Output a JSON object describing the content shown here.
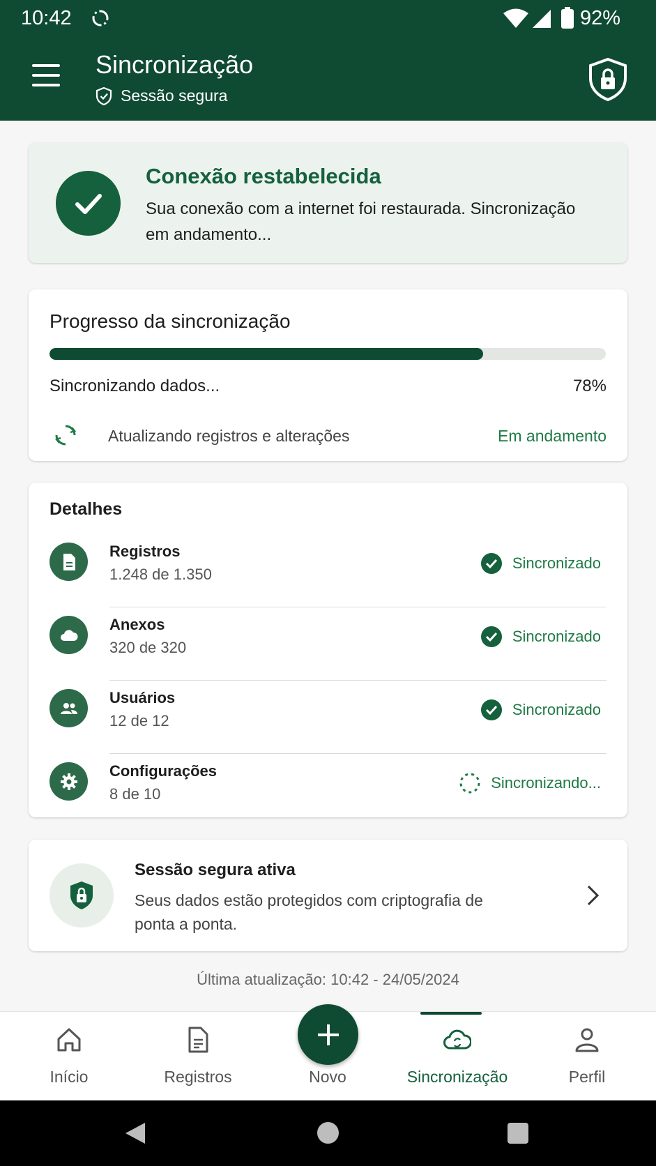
{
  "status_bar": {
    "time": "10:42",
    "battery": "92%"
  },
  "header": {
    "title": "Sincronização",
    "subtitle": "Sessão segura"
  },
  "alert": {
    "title": "Conexão restabelecida",
    "message": "Sua conexão com a internet foi restaurada. Sincronização em andamento..."
  },
  "progress": {
    "title": "Progresso da sincronização",
    "label": "Sincronizando dados...",
    "percent_text": "78%",
    "percent_value": 78,
    "task": "Atualizando registros e alterações",
    "task_status": "Em andamento"
  },
  "details": {
    "title": "Detalhes",
    "items": [
      {
        "name": "Registros",
        "count": "1.248 de 1.350",
        "status": "Sincronizado",
        "icon": "document-icon",
        "done": true
      },
      {
        "name": "Anexos",
        "count": "320 de 320",
        "status": "Sincronizado",
        "icon": "cloud-icon",
        "done": true
      },
      {
        "name": "Usuários",
        "count": "12 de 12",
        "status": "Sincronizado",
        "icon": "users-icon",
        "done": true
      },
      {
        "name": "Configurações",
        "count": "8 de 10",
        "status": "Sincronizando...",
        "icon": "gear-icon",
        "done": false
      }
    ]
  },
  "secure_session": {
    "title": "Sessão segura ativa",
    "message": "Seus dados estão protegidos com criptografia de ponta a ponta."
  },
  "last_update": "Última atualização: 10:42 - 24/05/2024",
  "bottom_nav": {
    "items": [
      {
        "label": "Início",
        "icon": "home-icon"
      },
      {
        "label": "Registros",
        "icon": "document-icon"
      },
      {
        "label": "Novo",
        "icon": "plus-icon"
      },
      {
        "label": "Sincronização",
        "icon": "cloud-sync-icon",
        "active": true
      },
      {
        "label": "Perfil",
        "icon": "person-icon"
      }
    ]
  },
  "colors": {
    "primary": "#0f4a33",
    "accent": "#15613d",
    "status_green": "#1f7a45"
  }
}
